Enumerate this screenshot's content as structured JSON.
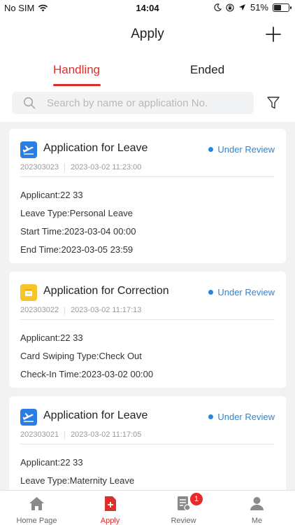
{
  "status_bar": {
    "carrier": "No SIM",
    "time": "14:04",
    "battery": "51%",
    "battery_level": 0.51
  },
  "header": {
    "title": "Apply"
  },
  "tabs": [
    {
      "label": "Handling",
      "active": true
    },
    {
      "label": "Ended",
      "active": false
    }
  ],
  "search": {
    "placeholder": "Search by name or application No."
  },
  "applications": [
    {
      "title": "Application for Leave",
      "icon": "leave-plane-icon",
      "status": "Under Review",
      "number": "202303023",
      "time": "2023-03-02 11:23:00",
      "details": [
        "Applicant:22 33",
        "Leave Type:Personal Leave",
        "Start Time:2023-03-04 00:00",
        "End Time:2023-03-05 23:59"
      ]
    },
    {
      "title": "Application for Correction",
      "icon": "correction-calendar-icon",
      "status": "Under Review",
      "number": "202303022",
      "time": "2023-03-02 11:17:13",
      "details": [
        "Applicant:22 33",
        "Card Swiping Type:Check Out",
        "Check-In Time:2023-03-02 00:00"
      ]
    },
    {
      "title": "Application for Leave",
      "icon": "leave-plane-icon",
      "status": "Under Review",
      "number": "202303021",
      "time": "2023-03-02 11:17:05",
      "details": [
        "Applicant:22 33",
        "Leave Type:Maternity Leave"
      ]
    }
  ],
  "bottom_nav": [
    {
      "label": "Home Page",
      "icon": "home-icon",
      "active": false
    },
    {
      "label": "Apply",
      "icon": "apply-icon",
      "active": true
    },
    {
      "label": "Review",
      "icon": "review-icon",
      "active": false,
      "badge": "1"
    },
    {
      "label": "Me",
      "icon": "user-icon",
      "active": false
    }
  ],
  "colors": {
    "accent": "#d9302c",
    "status": "#2a86d8",
    "leave_icon": "#2a7de1",
    "correction_icon": "#f7c52a"
  }
}
